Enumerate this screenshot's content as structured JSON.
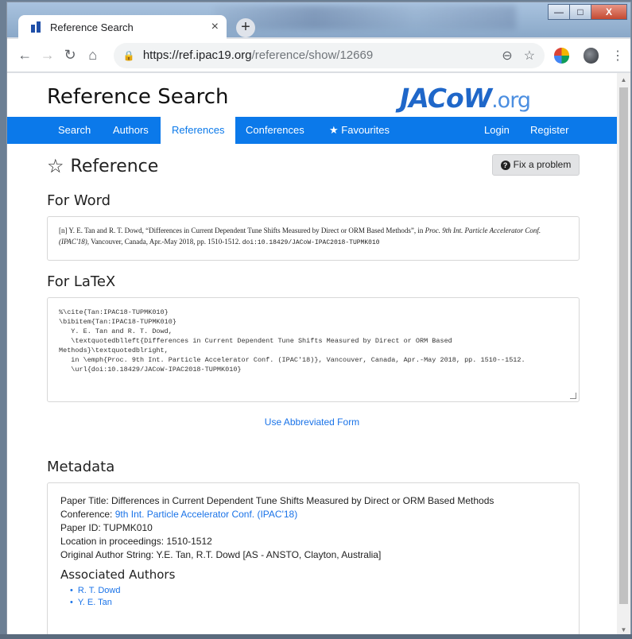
{
  "browser": {
    "tab_title": "Reference Search",
    "tab_close": "×",
    "new_tab": "+",
    "url_host": "https://ref.ipac19.org",
    "url_path": "/reference/show/12669",
    "win_min": "—",
    "win_max": "□",
    "win_close": "X"
  },
  "site": {
    "title": "Reference Search",
    "logo_main": "JACoW",
    "logo_suffix": ".org"
  },
  "nav": {
    "items": [
      {
        "label": "Search"
      },
      {
        "label": "Authors"
      },
      {
        "label": "References",
        "active": true
      },
      {
        "label": "Conferences"
      },
      {
        "label": "Favourites",
        "icon": "star-icon"
      }
    ],
    "login": "Login",
    "register": "Register"
  },
  "page": {
    "heading": "Reference",
    "fix_button": "Fix a problem",
    "for_word": "For Word",
    "for_latex": "For LaTeX",
    "metadata": "Metadata",
    "use_abbreviated": "Use Abbreviated Form"
  },
  "word_ref": {
    "prefix": "[n]  Y. E. Tan and R. T. Dowd, “Differences in Current Dependent Tune Shifts Measured by Direct or ORM Based Methods”, in ",
    "proc": "Proc. 9th Int. Particle Accelerator Conf. (IPAC'18)",
    "suffix": ", Vancouver, Canada, Apr.-May 2018, pp. 1510-1512. ",
    "doi": "doi:10.18429/JACoW-IPAC2018-TUPMK010"
  },
  "latex_ref": "%\\cite{Tan:IPAC18-TUPMK010}\n\\bibitem{Tan:IPAC18-TUPMK010}\n   Y. E. Tan and R. T. Dowd,\n   \\textquotedblleft{Differences in Current Dependent Tune Shifts Measured by Direct or ORM Based\nMethods}\\textquotedblright,\n   in \\emph{Proc. 9th Int. Particle Accelerator Conf. (IPAC'18)}, Vancouver, Canada, Apr.-May 2018, pp. 1510--1512.\n   \\url{doi:10.18429/JACoW-IPAC2018-TUPMK010}",
  "metadata": {
    "paper_title": "Paper Title: Differences in Current Dependent Tune Shifts Measured by Direct or ORM Based Methods",
    "conference_label": "Conference: ",
    "conference_link": "9th Int. Particle Accelerator Conf. (IPAC'18)",
    "paper_id": "Paper ID: TUPMK010",
    "location": "Location in proceedings: 1510-1512",
    "author_string": "Original Author String: Y.E. Tan, R.T. Dowd [AS - ANSTO, Clayton, Australia]",
    "associated_authors_heading": "Associated Authors",
    "authors": [
      "R. T. Dowd",
      "Y. E. Tan"
    ]
  }
}
